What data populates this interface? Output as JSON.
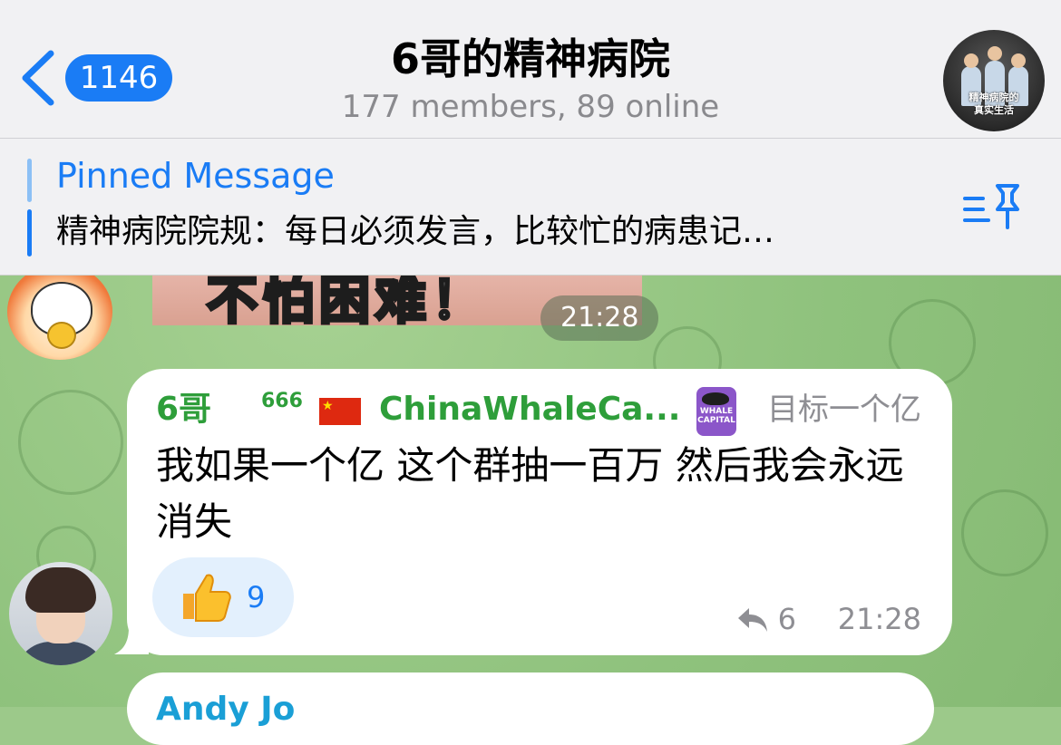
{
  "header": {
    "back_label": "back",
    "unread_count": "1146",
    "title": "6哥的精神病院",
    "subtitle": "177 members, 89 online",
    "avatar_caption_top": "精神病院的",
    "avatar_caption_bottom": "真实生活"
  },
  "pinned": {
    "label": "Pinned Message",
    "text": "精神病院院规：每日必须发言，比较忙的病患记…"
  },
  "media": {
    "overlay_text": "不怕困难！",
    "time": "21:28"
  },
  "message": {
    "sender_name": "6哥",
    "sender_tag": "666",
    "flag": "🇨🇳",
    "sender_title": "ChinaWhaleCa...",
    "badge_text": "WHALE CAPITAL",
    "admin_title": "目标一个亿",
    "text": "我如果一个亿 这个群抽一百万 然后我会永远消失",
    "reaction_emoji": "👍",
    "reaction_count": "9",
    "reply_count": "6",
    "time": "21:28"
  },
  "next_message": {
    "sender_name": "Andy Jo"
  },
  "colors": {
    "accent": "#1a7cf5",
    "sender": "#2e9e3a",
    "chat_bg": "#9cc98a"
  }
}
